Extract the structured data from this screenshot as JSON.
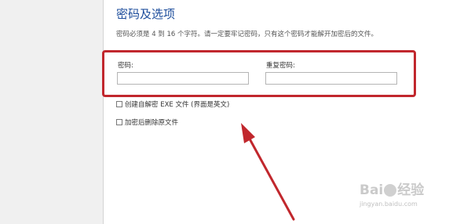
{
  "section": {
    "title": "密码及选项",
    "description": "密码必须是 4 到 16 个字符。请一定要牢记密码，只有这个密码才能解开加密后的文件。"
  },
  "password": {
    "label": "密码:",
    "value": "",
    "confirm_label": "重复密码:",
    "confirm_value": ""
  },
  "options": [
    {
      "label": "创建自解密 EXE 文件 (界面是英文)",
      "checked": false
    },
    {
      "label": "加密后删除原文件",
      "checked": false
    }
  ],
  "annotation": {
    "highlight_color": "#c1272d",
    "arrow_color": "#c1272d"
  },
  "watermark": {
    "logo_text_a": "Bai",
    "logo_text_b": "经验",
    "url": "jingyan.baidu.com"
  }
}
